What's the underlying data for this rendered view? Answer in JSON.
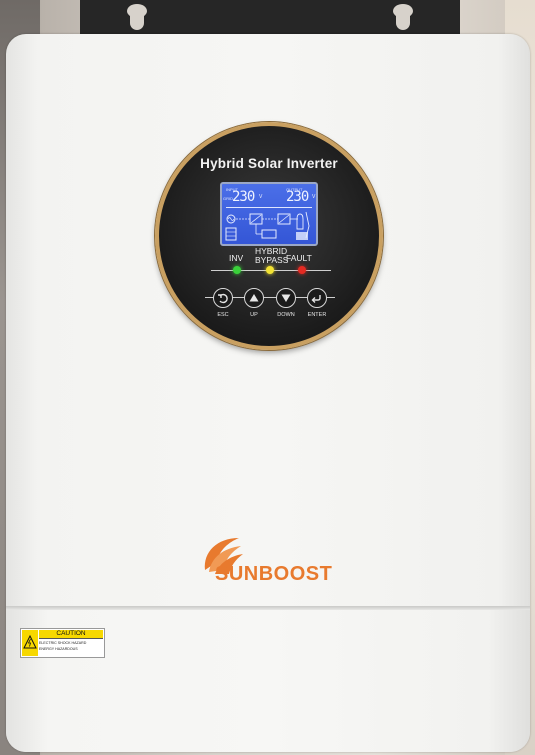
{
  "panel": {
    "title": "Hybrid Solar Inverter",
    "lcd": {
      "input_label": "INPUT",
      "output_label": "OUTPUT",
      "input_value": "230",
      "output_value": "230",
      "unit": "V",
      "side_label_left": "GRID"
    },
    "indicators": [
      {
        "label": "INV",
        "color": "#3ad13a"
      },
      {
        "label_line1": "HYBRID",
        "label_line2": "BYPASS",
        "color": "#f2e233"
      },
      {
        "label": "FAULT",
        "color": "#e52a22"
      }
    ],
    "buttons": [
      {
        "label": "ESC",
        "icon": "back-icon"
      },
      {
        "label": "UP",
        "icon": "triangle-up-icon"
      },
      {
        "label": "DOWN",
        "icon": "triangle-down-icon"
      },
      {
        "label": "ENTER",
        "icon": "enter-icon"
      }
    ]
  },
  "brand": {
    "name": "SUNBOOST",
    "color": "#e87a2e"
  },
  "caution_label": {
    "heading": "CAUTION",
    "line1": "ELECTRIC SHOCK HAZARD",
    "line2": "ENERGY HAZARDOUS"
  }
}
